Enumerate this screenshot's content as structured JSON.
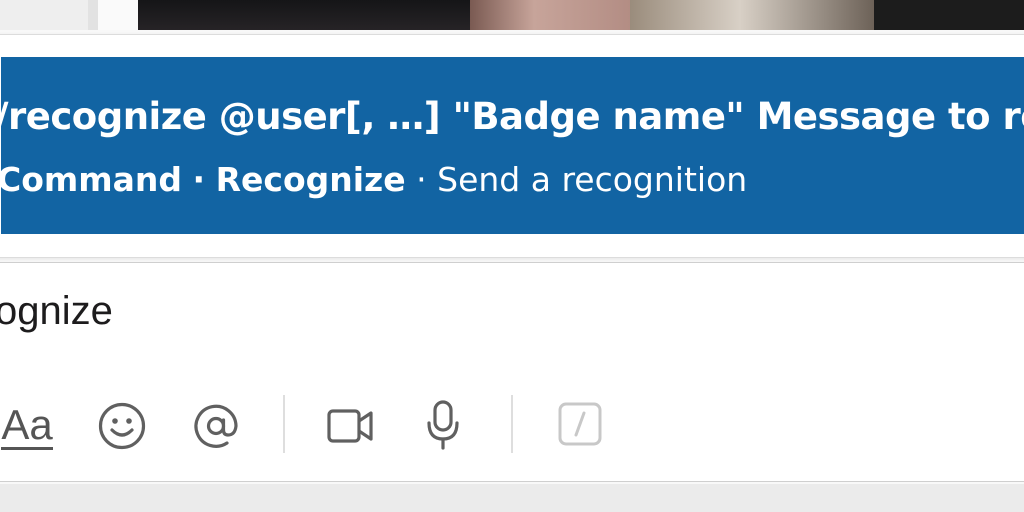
{
  "suggestion": {
    "syntax": "/recognize @user[, …] \"Badge name\" Message to reci",
    "type_label": "Command",
    "app_label": "Recognize",
    "separator": "·",
    "description": "Send a recognition"
  },
  "composer": {
    "typed_text": "ognize"
  },
  "toolbar": {
    "format_label": "Aa",
    "icons": [
      "text-format-icon",
      "emoji-icon",
      "mention-icon",
      "video-icon",
      "microphone-icon",
      "slash-command-icon"
    ]
  },
  "colors": {
    "highlight": "#1264a3",
    "icon_gray": "#606060",
    "disabled_icon": "#c8c8c8"
  }
}
